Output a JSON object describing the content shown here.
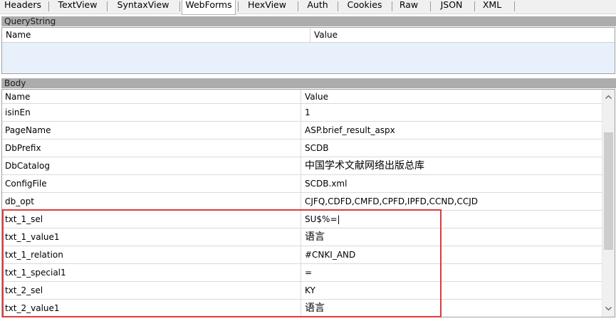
{
  "tabs": [
    {
      "label": "Headers"
    },
    {
      "label": "TextView"
    },
    {
      "label": "SyntaxView"
    },
    {
      "label": "WebForms",
      "active": true
    },
    {
      "label": "HexView"
    },
    {
      "label": "Auth"
    },
    {
      "label": "Cookies"
    },
    {
      "label": "Raw"
    },
    {
      "label": "JSON"
    },
    {
      "label": "XML"
    }
  ],
  "querystring": {
    "title": "QueryString",
    "col_name": "Name",
    "col_value": "Value"
  },
  "body": {
    "title": "Body",
    "col_name": "Name",
    "col_value": "Value",
    "rows": [
      {
        "name": "isinEn",
        "value": "1"
      },
      {
        "name": "PageName",
        "value": "ASP.brief_result_aspx"
      },
      {
        "name": "DbPrefix",
        "value": "SCDB"
      },
      {
        "name": "DbCatalog",
        "value": "中国学术文献网络出版总库"
      },
      {
        "name": "ConfigFile",
        "value": "SCDB.xml"
      },
      {
        "name": "db_opt",
        "value": "CJFQ,CDFD,CMFD,CPFD,IPFD,CCND,CCJD"
      },
      {
        "name": "txt_1_sel",
        "value": "SU$%=|"
      },
      {
        "name": "txt_1_value1",
        "value": "语言"
      },
      {
        "name": "txt_1_relation",
        "value": "#CNKI_AND"
      },
      {
        "name": "txt_1_special1",
        "value": "="
      },
      {
        "name": "txt_2_sel",
        "value": "KY"
      },
      {
        "name": "txt_2_value1",
        "value": "语言"
      }
    ]
  },
  "scrollbar": {
    "up_icon": "scroll-up-arrow",
    "down_icon": "scroll-down-arrow"
  },
  "highlight_color": "#e03a3a"
}
